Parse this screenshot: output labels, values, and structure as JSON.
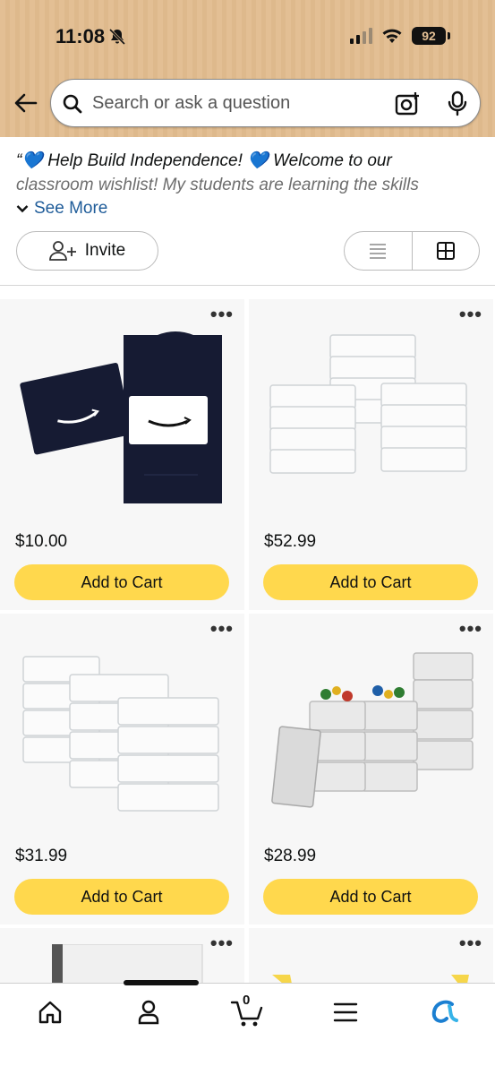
{
  "status_bar": {
    "time": "11:08",
    "battery": "92"
  },
  "search": {
    "placeholder": "Search or ask a question"
  },
  "list": {
    "description_line1": "“💙 Help Build Independence! 💙 Welcome to our",
    "description_line2": "classroom wishlist! My students are learning the skills",
    "see_more": "See More",
    "invite_label": "Invite"
  },
  "items": [
    {
      "price": "$10.00",
      "button": "Add to Cart",
      "image": "amazon-gift-card"
    },
    {
      "price": "$52.99",
      "button": "Add to Cart",
      "image": "plastic-storage-bins"
    },
    {
      "price": "$31.99",
      "button": "Add to Cart",
      "image": "shoe-box-storage-containers"
    },
    {
      "price": "$28.99",
      "button": "Add to Cart",
      "image": "woven-storage-baskets"
    }
  ],
  "bottom_nav": {
    "cart_count": "0",
    "items": [
      "home-icon",
      "account-icon",
      "cart-icon",
      "menu-icon",
      "rufus-icon"
    ]
  },
  "colors": {
    "header": "#e3bf94",
    "button": "#ffd84d",
    "link": "#1f5c99"
  }
}
